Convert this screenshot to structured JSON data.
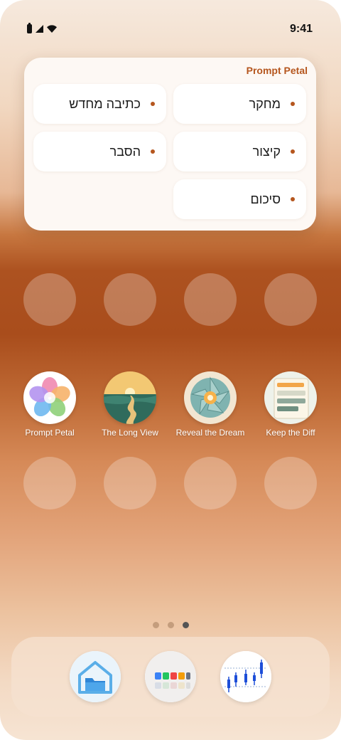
{
  "status_bar": {
    "time": "9:41",
    "icons": [
      "battery-icon",
      "signal-icon",
      "wifi-icon"
    ]
  },
  "widget": {
    "title": "Prompt Petal",
    "items": [
      {
        "label": "מחקר"
      },
      {
        "label": "כתיבה מחדש"
      },
      {
        "label": "קיצור"
      },
      {
        "label": "הסבר"
      },
      {
        "label": "סיכום"
      }
    ],
    "accent_color": "#b5561e"
  },
  "apps": [
    {
      "label": "Prompt Petal",
      "icon": "flower-icon"
    },
    {
      "label": "The Long View",
      "icon": "winding-road-icon"
    },
    {
      "label": "Reveal the Dream",
      "icon": "aperture-icon"
    },
    {
      "label": "Keep the Diff",
      "icon": "document-diff-icon"
    }
  ],
  "page_indicator": {
    "count": 3,
    "active_index": 2
  },
  "dock": {
    "apps": [
      {
        "icon": "files-folder-icon"
      },
      {
        "icon": "color-swatches-icon"
      },
      {
        "icon": "candlestick-chart-icon"
      }
    ]
  }
}
